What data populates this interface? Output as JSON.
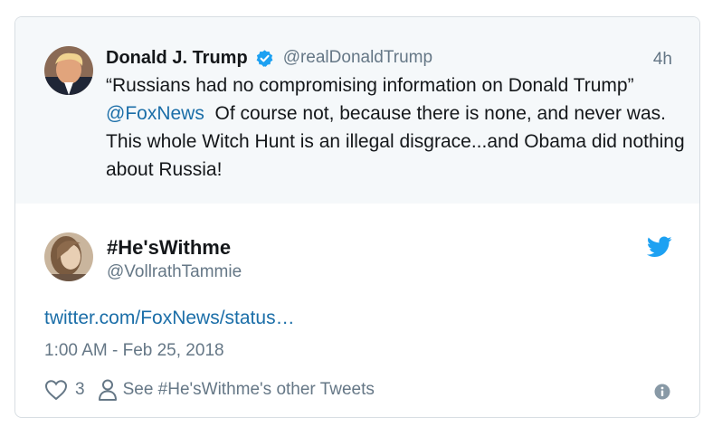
{
  "quoted_tweet": {
    "author_name": "Donald J. Trump",
    "author_handle": "@realDonaldTrump",
    "time": "4h",
    "text_line1": "“Russians had no compromising information on Donald Trump”",
    "mention": "@FoxNews",
    "text_rest": "Of course not, because there is none, and never was. This whole Witch Hunt is an illegal disgrace...and Obama did nothing about Russia!",
    "verified_icon": "verified-badge-icon"
  },
  "tweet": {
    "author_name": "#He'sWithme",
    "author_handle": "@VollrathTammie",
    "link": "twitter.com/FoxNews/status…",
    "timestamp": "1:00 AM - Feb 25, 2018",
    "like_count": "3",
    "other_tweets_label": "See #He'sWithme's other Tweets"
  },
  "colors": {
    "link": "#1b6ea8",
    "muted": "#657786",
    "twitter_blue": "#1da1f2",
    "quoted_bg": "#f5f8fa",
    "border": "#d8dee3"
  }
}
